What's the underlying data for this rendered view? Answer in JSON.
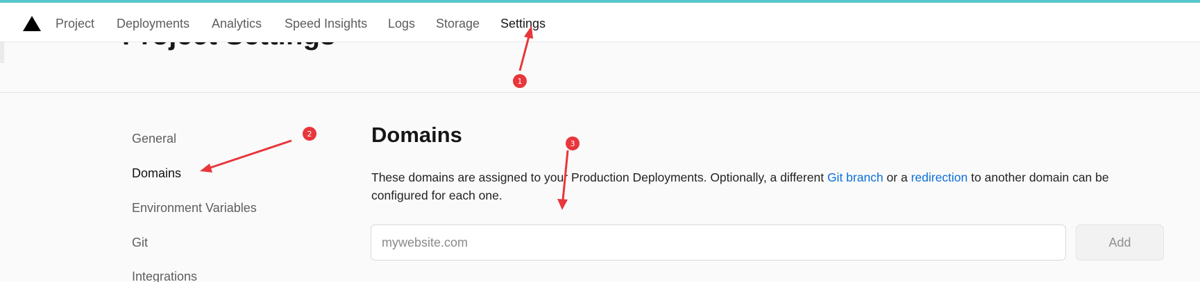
{
  "nav": {
    "logo_icon": "triangle-logo-icon",
    "items": [
      {
        "label": "Project"
      },
      {
        "label": "Deployments"
      },
      {
        "label": "Analytics"
      },
      {
        "label": "Speed Insights"
      },
      {
        "label": "Logs"
      },
      {
        "label": "Storage"
      },
      {
        "label": "Settings",
        "active": true
      }
    ]
  },
  "header": {
    "title": "Project Settings"
  },
  "sidebar": {
    "items": [
      {
        "label": "General"
      },
      {
        "label": "Domains",
        "active": true
      },
      {
        "label": "Environment Variables"
      },
      {
        "label": "Git"
      },
      {
        "label": "Integrations"
      }
    ]
  },
  "domains": {
    "title": "Domains",
    "description_before": "These domains are assigned to your Production Deployments. Optionally, a different ",
    "git_branch_link": "Git branch",
    "description_middle": " or a ",
    "redirection_link": "redirection",
    "description_after": " to another domain can be configured for each one.",
    "input": {
      "value": "",
      "placeholder": "mywebsite.com"
    },
    "add_label": "Add"
  },
  "annotations": {
    "badges": [
      "1",
      "2",
      "3"
    ],
    "color": "#e8363a"
  },
  "colors": {
    "accent_bar": "#56c8cc",
    "link": "#0a6fd9"
  }
}
